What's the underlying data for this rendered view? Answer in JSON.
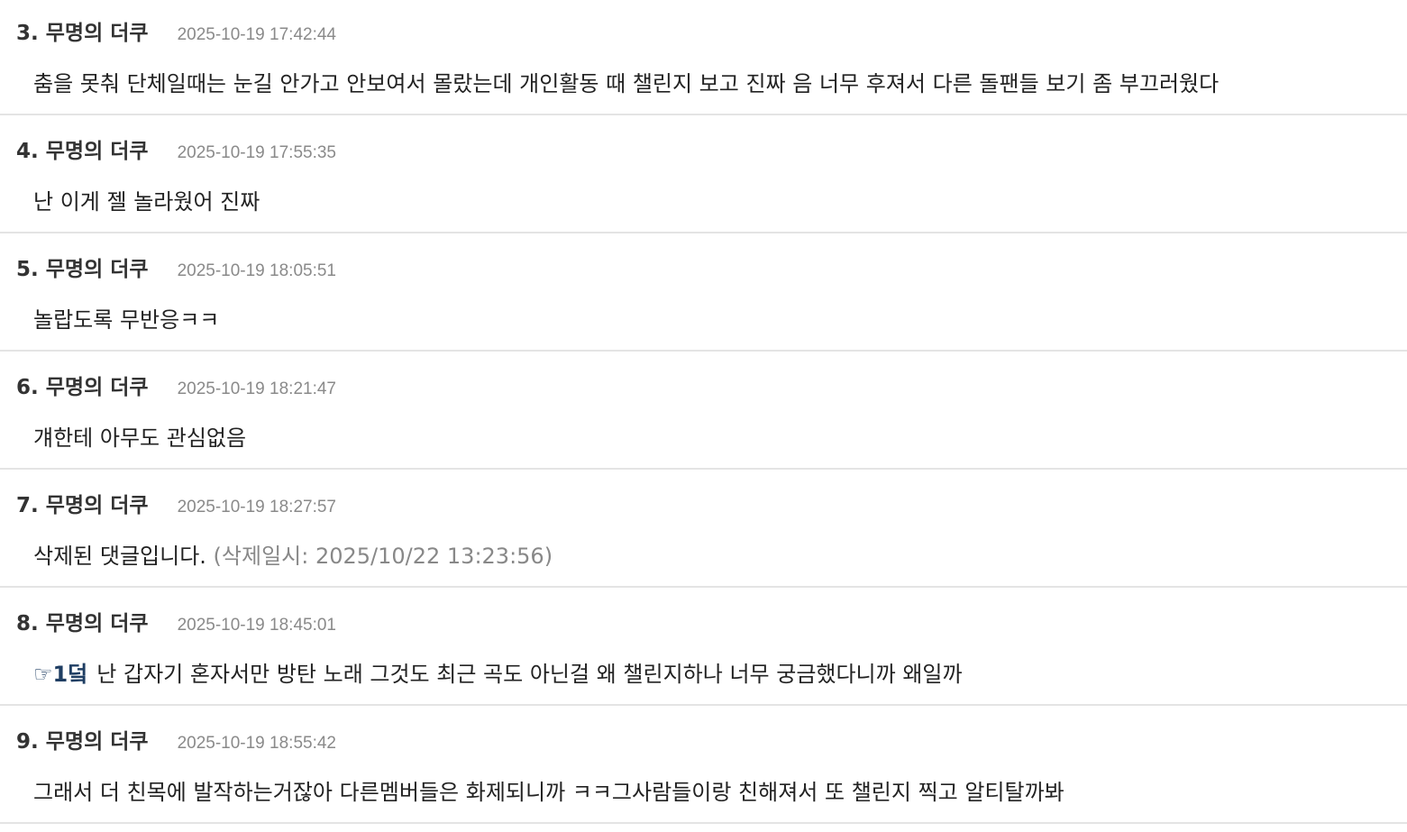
{
  "comments": [
    {
      "num": "3.",
      "author": "무명의 더쿠",
      "time": "2025-10-19 17:42:44",
      "text": "춤을 못춰 단체일때는 눈길 안가고 안보여서 몰랐는데 개인활동 때 챌린지 보고 진짜 음 너무 후져서 다른 돌팬들 보기 좀 부끄러웠다"
    },
    {
      "num": "4.",
      "author": "무명의 더쿠",
      "time": "2025-10-19 17:55:35",
      "text": "난 이게 젤 놀라웠어 진짜"
    },
    {
      "num": "5.",
      "author": "무명의 더쿠",
      "time": "2025-10-19 18:05:51",
      "text": "놀랍도록 무반응ㅋㅋ"
    },
    {
      "num": "6.",
      "author": "무명의 더쿠",
      "time": "2025-10-19 18:21:47",
      "text": "걔한테 아무도 관심없음"
    },
    {
      "num": "7.",
      "author": "무명의 더쿠",
      "time": "2025-10-19 18:27:57",
      "text": "삭제된 댓글입니다.",
      "deleted_note": "(삭제일시: 2025/10/22 13:23:56)"
    },
    {
      "num": "8.",
      "author": "무명의 더쿠",
      "time": "2025-10-19 18:45:01",
      "reply_ref": "☞1덬",
      "text": "난 갑자기 혼자서만 방탄 노래 그것도 최근 곡도 아닌걸 왜 챌린지하나 너무 궁금했다니까 왜일까"
    },
    {
      "num": "9.",
      "author": "무명의 더쿠",
      "time": "2025-10-19 18:55:42",
      "text": "그래서 더 친목에 발작하는거잖아 다른멤버들은 화제되니까 ㅋㅋ그사람들이랑 친해져서 또 챌린지 찍고 알티탈까봐"
    }
  ],
  "colors": {
    "separator": "#e4e4e4",
    "timestamp": "#8a8a8a",
    "reply_ref": "#1f3e63"
  }
}
